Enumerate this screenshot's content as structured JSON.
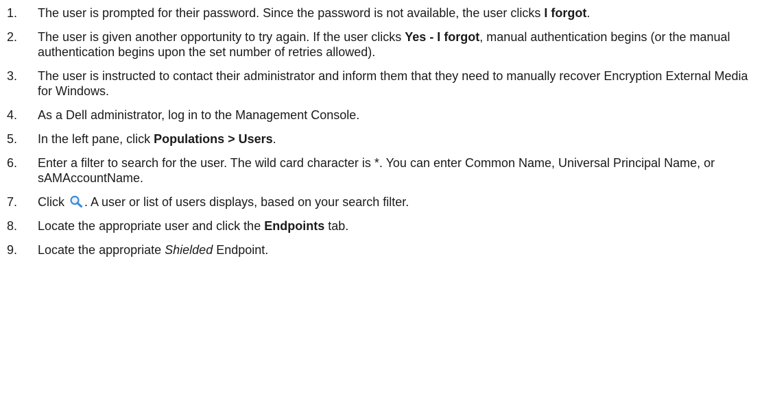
{
  "steps": [
    {
      "number": "1.",
      "parts": [
        {
          "text": "The user is prompted for their password. Since the password is not available, the user clicks "
        },
        {
          "text": "I forgot",
          "style": "bold"
        },
        {
          "text": "."
        }
      ]
    },
    {
      "number": "2.",
      "parts": [
        {
          "text": "The user is given another opportunity to try again. If the user clicks "
        },
        {
          "text": "Yes - I forgot",
          "style": "bold"
        },
        {
          "text": ", manual authentication begins (or the manual authentication begins upon the set number of retries allowed)."
        }
      ]
    },
    {
      "number": "3.",
      "parts": [
        {
          "text": "The user is instructed to contact their administrator and inform them that they need to manually recover Encryption External Media for Windows."
        }
      ]
    },
    {
      "number": "4.",
      "parts": [
        {
          "text": "As a Dell administrator, log in to the Management Console."
        }
      ]
    },
    {
      "number": "5.",
      "parts": [
        {
          "text": "In the left pane, click "
        },
        {
          "text": "Populations > Users",
          "style": "bold"
        },
        {
          "text": "."
        }
      ]
    },
    {
      "number": "6.",
      "parts": [
        {
          "text": "Enter a filter to search for the user. The wild card character is *. You can enter Common Name, Universal Principal Name, or sAMAccountName."
        }
      ]
    },
    {
      "number": "7.",
      "parts": [
        {
          "text": "Click "
        },
        {
          "icon": "search-icon"
        },
        {
          "text": ". A user or list of users displays, based on your search filter."
        }
      ]
    },
    {
      "number": "8.",
      "parts": [
        {
          "text": "Locate the appropriate user and click the "
        },
        {
          "text": "Endpoints",
          "style": "bold"
        },
        {
          "text": " tab."
        }
      ]
    },
    {
      "number": "9.",
      "parts": [
        {
          "text": "Locate the appropriate "
        },
        {
          "text": "Shielded",
          "style": "italic"
        },
        {
          "text": " Endpoint."
        }
      ]
    }
  ],
  "colors": {
    "text": "#1a1a1a",
    "icon_blue": "#3c8ad6"
  }
}
